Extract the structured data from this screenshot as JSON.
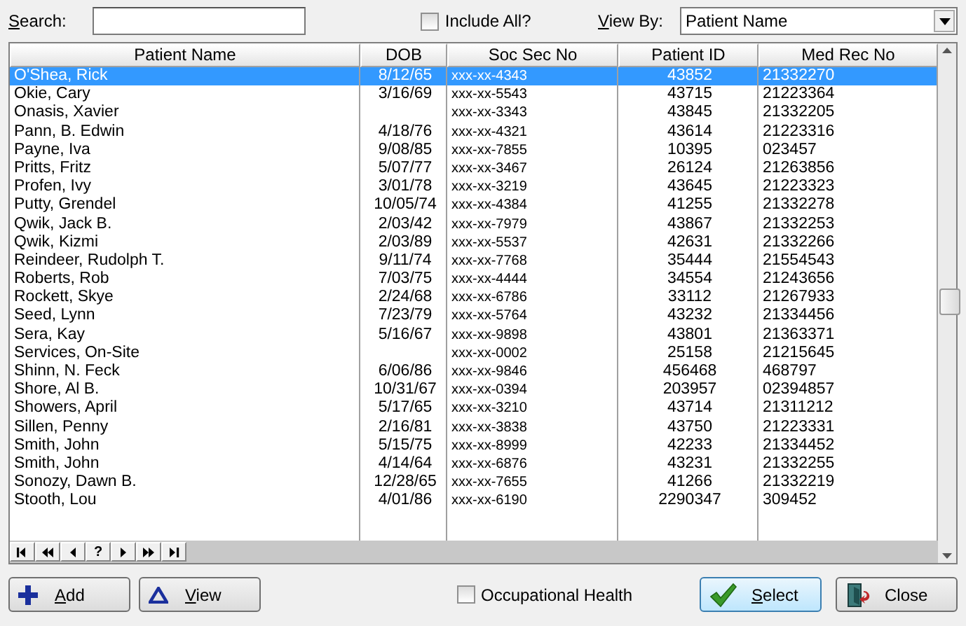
{
  "search": {
    "label": "Search:"
  },
  "include_all": {
    "label": "Include All?",
    "checked": false
  },
  "view_by": {
    "label": "View By:",
    "value": "Patient Name"
  },
  "table": {
    "columns": [
      "Patient Name",
      "DOB",
      "Soc Sec No",
      "Patient ID",
      "Med Rec No"
    ],
    "rows": [
      {
        "cells": [
          "O'Shea, Rick",
          "8/12/65",
          "xxx-xx-4343",
          "43852",
          "21332270"
        ],
        "selected": true
      },
      {
        "cells": [
          "Okie, Cary",
          "3/16/69",
          "xxx-xx-5543",
          "43715",
          "21223364"
        ],
        "selected": false
      },
      {
        "cells": [
          "Onasis, Xavier",
          "",
          "xxx-xx-3343",
          "43845",
          "21332205"
        ],
        "selected": false
      },
      {
        "cells": [
          "Pann, B. Edwin",
          "4/18/76",
          "xxx-xx-4321",
          "43614",
          "21223316"
        ],
        "selected": false
      },
      {
        "cells": [
          "Payne, Iva",
          "9/08/85",
          "xxx-xx-7855",
          "10395",
          "023457"
        ],
        "selected": false
      },
      {
        "cells": [
          "Pritts, Fritz",
          "5/07/77",
          "xxx-xx-3467",
          "26124",
          "21263856"
        ],
        "selected": false
      },
      {
        "cells": [
          "Profen, Ivy",
          "3/01/78",
          "xxx-xx-3219",
          "43645",
          "21223323"
        ],
        "selected": false
      },
      {
        "cells": [
          "Putty, Grendel",
          "10/05/74",
          "xxx-xx-4384",
          "41255",
          "21332278"
        ],
        "selected": false
      },
      {
        "cells": [
          "Qwik, Jack B.",
          "2/03/42",
          "xxx-xx-7979",
          "43867",
          "21332253"
        ],
        "selected": false
      },
      {
        "cells": [
          "Qwik, Kizmi",
          "2/03/89",
          "xxx-xx-5537",
          "42631",
          "21332266"
        ],
        "selected": false
      },
      {
        "cells": [
          "Reindeer, Rudolph T.",
          "9/11/74",
          "xxx-xx-7768",
          "35444",
          "21554543"
        ],
        "selected": false
      },
      {
        "cells": [
          "Roberts, Rob",
          "7/03/75",
          "xxx-xx-4444",
          "34554",
          "21243656"
        ],
        "selected": false
      },
      {
        "cells": [
          "Rockett, Skye",
          "2/24/68",
          "xxx-xx-6786",
          "33112",
          "21267933"
        ],
        "selected": false
      },
      {
        "cells": [
          "Seed, Lynn",
          "7/23/79",
          "xxx-xx-5764",
          "43232",
          "21334456"
        ],
        "selected": false
      },
      {
        "cells": [
          "Sera, Kay",
          "5/16/67",
          "xxx-xx-9898",
          "43801",
          "21363371"
        ],
        "selected": false
      },
      {
        "cells": [
          "Services, On-Site",
          "",
          "xxx-xx-0002",
          "25158",
          "21215645"
        ],
        "selected": false
      },
      {
        "cells": [
          "Shinn, N. Feck",
          "6/06/86",
          "xxx-xx-9846",
          "456468",
          "468797"
        ],
        "selected": false
      },
      {
        "cells": [
          "Shore, Al B.",
          "10/31/67",
          "xxx-xx-0394",
          "203957",
          "02394857"
        ],
        "selected": false
      },
      {
        "cells": [
          "Showers, April",
          "5/17/65",
          "xxx-xx-3210",
          "43714",
          "21311212"
        ],
        "selected": false
      },
      {
        "cells": [
          "Sillen, Penny",
          "2/16/81",
          "xxx-xx-3838",
          "43750",
          "21223331"
        ],
        "selected": false
      },
      {
        "cells": [
          "Smith, John",
          "5/15/75",
          "xxx-xx-8999",
          "42233",
          "21334452"
        ],
        "selected": false
      },
      {
        "cells": [
          "Smith, John",
          "4/14/64",
          "xxx-xx-6876",
          "43231",
          "21332255"
        ],
        "selected": false
      },
      {
        "cells": [
          "Sonozy, Dawn B.",
          "12/28/65",
          "xxx-xx-7655",
          "41266",
          "21332219"
        ],
        "selected": false
      },
      {
        "cells": [
          "Stooth, Lou",
          "4/01/86",
          "xxx-xx-6190",
          "2290347",
          "309452"
        ],
        "selected": false
      }
    ]
  },
  "navigator": [
    {
      "kind": "first"
    },
    {
      "kind": "prev-page"
    },
    {
      "kind": "prev"
    },
    {
      "kind": "help",
      "label": "?"
    },
    {
      "kind": "next"
    },
    {
      "kind": "next-page"
    },
    {
      "kind": "last"
    }
  ],
  "buttons_left": [
    {
      "kind": "add",
      "label": "Add"
    },
    {
      "kind": "view",
      "label": "View"
    }
  ],
  "occupational_health": {
    "label": "Occupational Health",
    "checked": false
  },
  "buttons_right": [
    {
      "kind": "select",
      "label": "Select"
    },
    {
      "kind": "close",
      "label": "Close"
    }
  ]
}
